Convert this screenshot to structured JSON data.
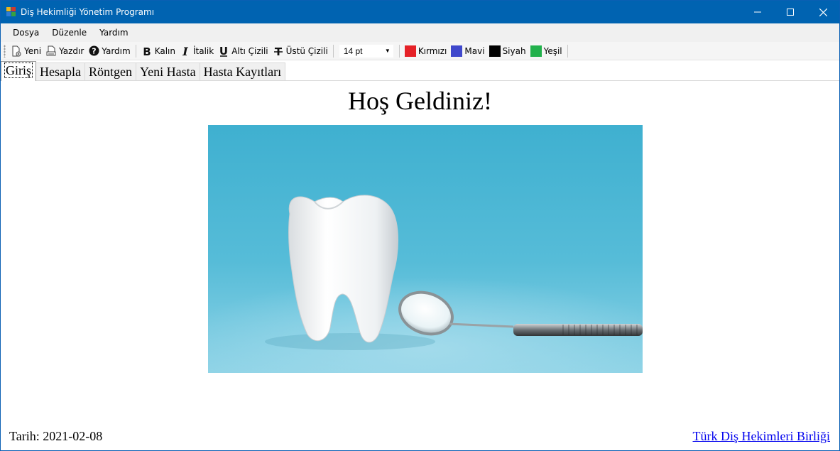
{
  "window": {
    "title": "Diş Hekimliği Yönetim Programı"
  },
  "menu": {
    "items": [
      "Dosya",
      "Düzenle",
      "Yardım"
    ]
  },
  "toolbar": {
    "new_label": "Yeni",
    "print_label": "Yazdır",
    "help_label": "Yardım",
    "bold_label": "Kalın",
    "italic_label": "İtalik",
    "underline_label": "Altı Çizili",
    "strike_label": "Üstü Çizili",
    "font_size": "14 pt",
    "colors": [
      {
        "label": "Kırmızı",
        "hex": "#e52127"
      },
      {
        "label": "Mavi",
        "hex": "#3f48cc"
      },
      {
        "label": "Siyah",
        "hex": "#000000"
      },
      {
        "label": "Yeşil",
        "hex": "#22b14c"
      }
    ]
  },
  "tabs": [
    "Giriş",
    "Hesapla",
    "Röntgen",
    "Yeni Hasta",
    "Hasta Kayıtları"
  ],
  "main": {
    "welcome": "Hoş Geldiniz!",
    "date_label": "Tarih:",
    "date_value": "2021-02-08",
    "link_text": "Türk Diş Hekimleri Birliği"
  }
}
